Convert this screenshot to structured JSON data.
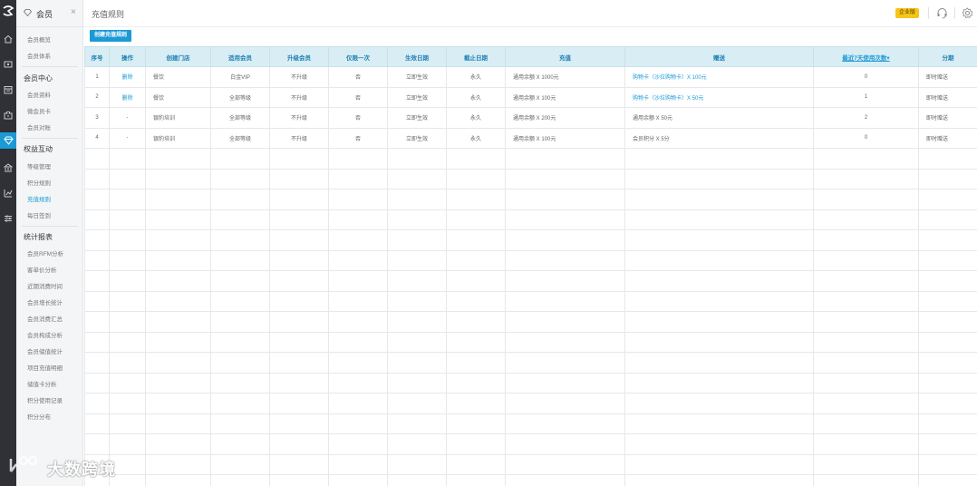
{
  "sidebar": {
    "title": "会员",
    "close": "×",
    "items_top": [
      "会员概览",
      "会员体系"
    ],
    "group_center": "会员中心",
    "items_center": [
      "会员资料",
      "微会员卡",
      "会员对账"
    ],
    "group_rights": "权益互动",
    "items_rights": [
      "等级管理",
      "积分规则",
      "充值规则",
      "每日签到"
    ],
    "group_stats": "统计报表",
    "items_stats": [
      "会员RFM分析",
      "客单价分析",
      "近期消费时间",
      "会员增长统计",
      "会员消费汇总",
      "会员构成分析",
      "会员储值统计",
      "项目充值明细",
      "储值卡分析",
      "积分使用记录",
      "积分分布"
    ]
  },
  "topbar": {
    "page_title": "充值规则",
    "edition_badge": "企业版"
  },
  "toolbar": {
    "create_label": "创建充值规则"
  },
  "table": {
    "headers": [
      "序号",
      "操作",
      "创建门店",
      "适用会员",
      "升级会员",
      "仅限一次",
      "生效日期",
      "截止日期",
      "充值",
      "赠送",
      "最近7天使用次数",
      "分期"
    ],
    "sort_arrow": "▾",
    "rows": [
      {
        "no": "1",
        "action": "删除",
        "store": "餐饮",
        "member": "白金VIP",
        "upgrade": "不升级",
        "once": "否",
        "start": "立即生效",
        "end": "永久",
        "recharge": "通用余额 X 1000元",
        "gift": "购物卡（沙拉购物卡）X 100元",
        "uses": "0",
        "install": "即时赠送"
      },
      {
        "no": "2",
        "action": "删除",
        "store": "餐饮",
        "member": "全部等级",
        "upgrade": "不升级",
        "once": "否",
        "start": "立即生效",
        "end": "永久",
        "recharge": "通用余额 X 100元",
        "gift": "购物卡（沙拉购物卡）X 50元",
        "uses": "1",
        "install": "即时赠送"
      },
      {
        "no": "3",
        "action": "-",
        "store": "银豹培训",
        "member": "全部等级",
        "upgrade": "不升级",
        "once": "否",
        "start": "立即生效",
        "end": "永久",
        "recharge": "通用余额 X 200元",
        "gift": "通用余额 X 50元",
        "uses": "2",
        "install": "即时赠送"
      },
      {
        "no": "4",
        "action": "-",
        "store": "银豹培训",
        "member": "全部等级",
        "upgrade": "不升级",
        "once": "否",
        "start": "立即生效",
        "end": "永久",
        "recharge": "通用余额 X 100元",
        "gift": "会员积分 X 5分",
        "uses": "0",
        "install": "即时赠送"
      }
    ]
  },
  "watermark": "大数跨境",
  "colors": {
    "accent": "#1c9ad6",
    "rail": "#2f3136",
    "header_bg": "#d9edf4",
    "badge": "#f5c518"
  },
  "icons": {
    "rail": [
      "logo-icon",
      "home-icon",
      "monitor-icon",
      "calendar-icon",
      "briefcase-icon",
      "diamond-icon",
      "bank-icon",
      "chart-icon",
      "settings-sliders-icon"
    ],
    "topbar": [
      "headset-icon",
      "gear-icon"
    ]
  }
}
